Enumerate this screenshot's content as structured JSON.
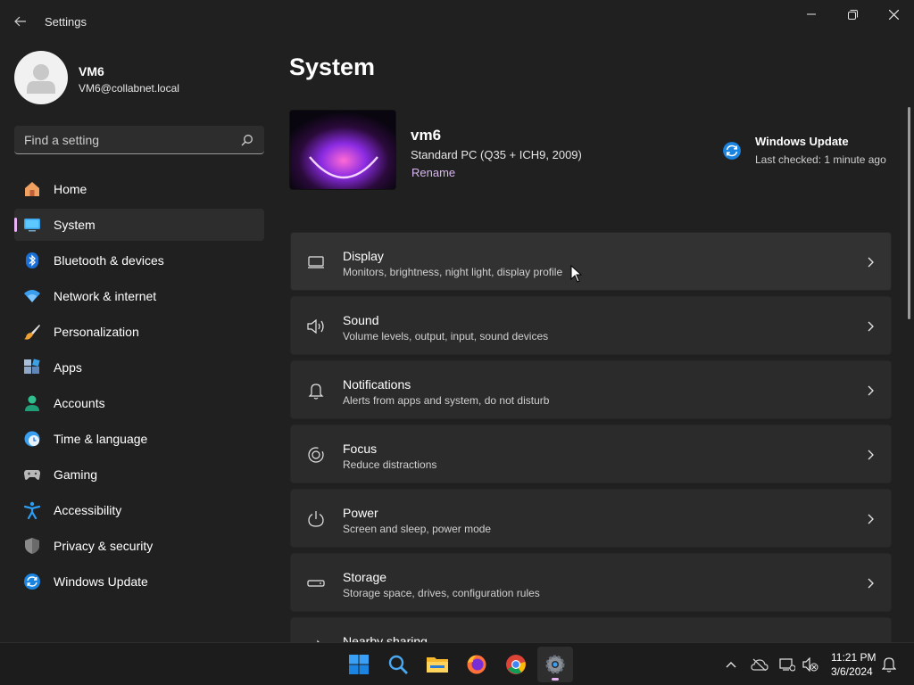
{
  "window": {
    "title": "Settings",
    "back_label": "Back",
    "minimize": "Minimize",
    "maximize": "Maximize",
    "close": "Close"
  },
  "user": {
    "name": "VM6",
    "email": "VM6@collabnet.local"
  },
  "search": {
    "placeholder": "Find a setting"
  },
  "sidebar": {
    "items": [
      {
        "label": "Home",
        "icon": "home-icon"
      },
      {
        "label": "System",
        "icon": "system-icon",
        "selected": true
      },
      {
        "label": "Bluetooth & devices",
        "icon": "bluetooth-icon"
      },
      {
        "label": "Network & internet",
        "icon": "wifi-icon"
      },
      {
        "label": "Personalization",
        "icon": "brush-icon"
      },
      {
        "label": "Apps",
        "icon": "apps-icon"
      },
      {
        "label": "Accounts",
        "icon": "accounts-icon"
      },
      {
        "label": "Time & language",
        "icon": "clock-globe-icon"
      },
      {
        "label": "Gaming",
        "icon": "gamepad-icon"
      },
      {
        "label": "Accessibility",
        "icon": "accessibility-icon"
      },
      {
        "label": "Privacy & security",
        "icon": "shield-icon"
      },
      {
        "label": "Windows Update",
        "icon": "windows-update-icon"
      }
    ]
  },
  "main": {
    "title": "System",
    "pc": {
      "name": "vm6",
      "model": "Standard PC (Q35 + ICH9, 2009)",
      "rename": "Rename"
    },
    "update": {
      "title": "Windows Update",
      "status": "Last checked: 1 minute ago"
    },
    "cards": [
      {
        "title": "Display",
        "desc": "Monitors, brightness, night light, display profile",
        "icon": "monitor-icon"
      },
      {
        "title": "Sound",
        "desc": "Volume levels, output, input, sound devices",
        "icon": "speaker-icon"
      },
      {
        "title": "Notifications",
        "desc": "Alerts from apps and system, do not disturb",
        "icon": "bell-icon"
      },
      {
        "title": "Focus",
        "desc": "Reduce distractions",
        "icon": "focus-icon"
      },
      {
        "title": "Power",
        "desc": "Screen and sleep, power mode",
        "icon": "power-icon"
      },
      {
        "title": "Storage",
        "desc": "Storage space, drives, configuration rules",
        "icon": "storage-icon"
      },
      {
        "title": "Nearby sharing",
        "desc": "",
        "icon": "share-icon"
      }
    ]
  },
  "taskbar": {
    "apps": [
      "start-icon",
      "search-icon",
      "file-explorer-icon",
      "firefox-icon",
      "chrome-icon",
      "settings-icon"
    ],
    "time": "11:21 PM",
    "date": "3/6/2024"
  },
  "colors": {
    "background": "#202020",
    "card": "#2b2b2b",
    "accent": "#e8b3f5"
  }
}
